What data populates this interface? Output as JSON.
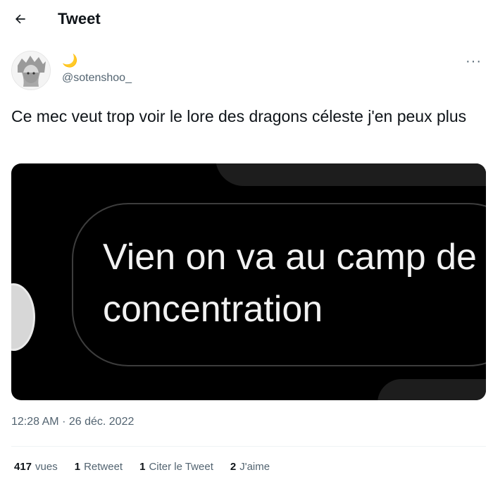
{
  "header": {
    "title": "Tweet"
  },
  "author": {
    "display_name": "🌙",
    "handle": "@sotenshoo_"
  },
  "tweet": {
    "text": "Ce mec veut trop voir le lore des dragons céleste j'en peux plus",
    "time": "12:28 AM",
    "separator": "·",
    "date": "26 déc. 2022"
  },
  "media": {
    "line1": "Vien on va au camp de",
    "line2": "concentration"
  },
  "stats": {
    "views_count": "417",
    "views_label": "vues",
    "retweets_count": "1",
    "retweets_label": "Retweet",
    "quotes_count": "1",
    "quotes_label": "Citer le Tweet",
    "likes_count": "2",
    "likes_label": "J'aime"
  },
  "icons": {
    "back": "arrow-left-icon",
    "more": "more-horizontal-icon"
  }
}
